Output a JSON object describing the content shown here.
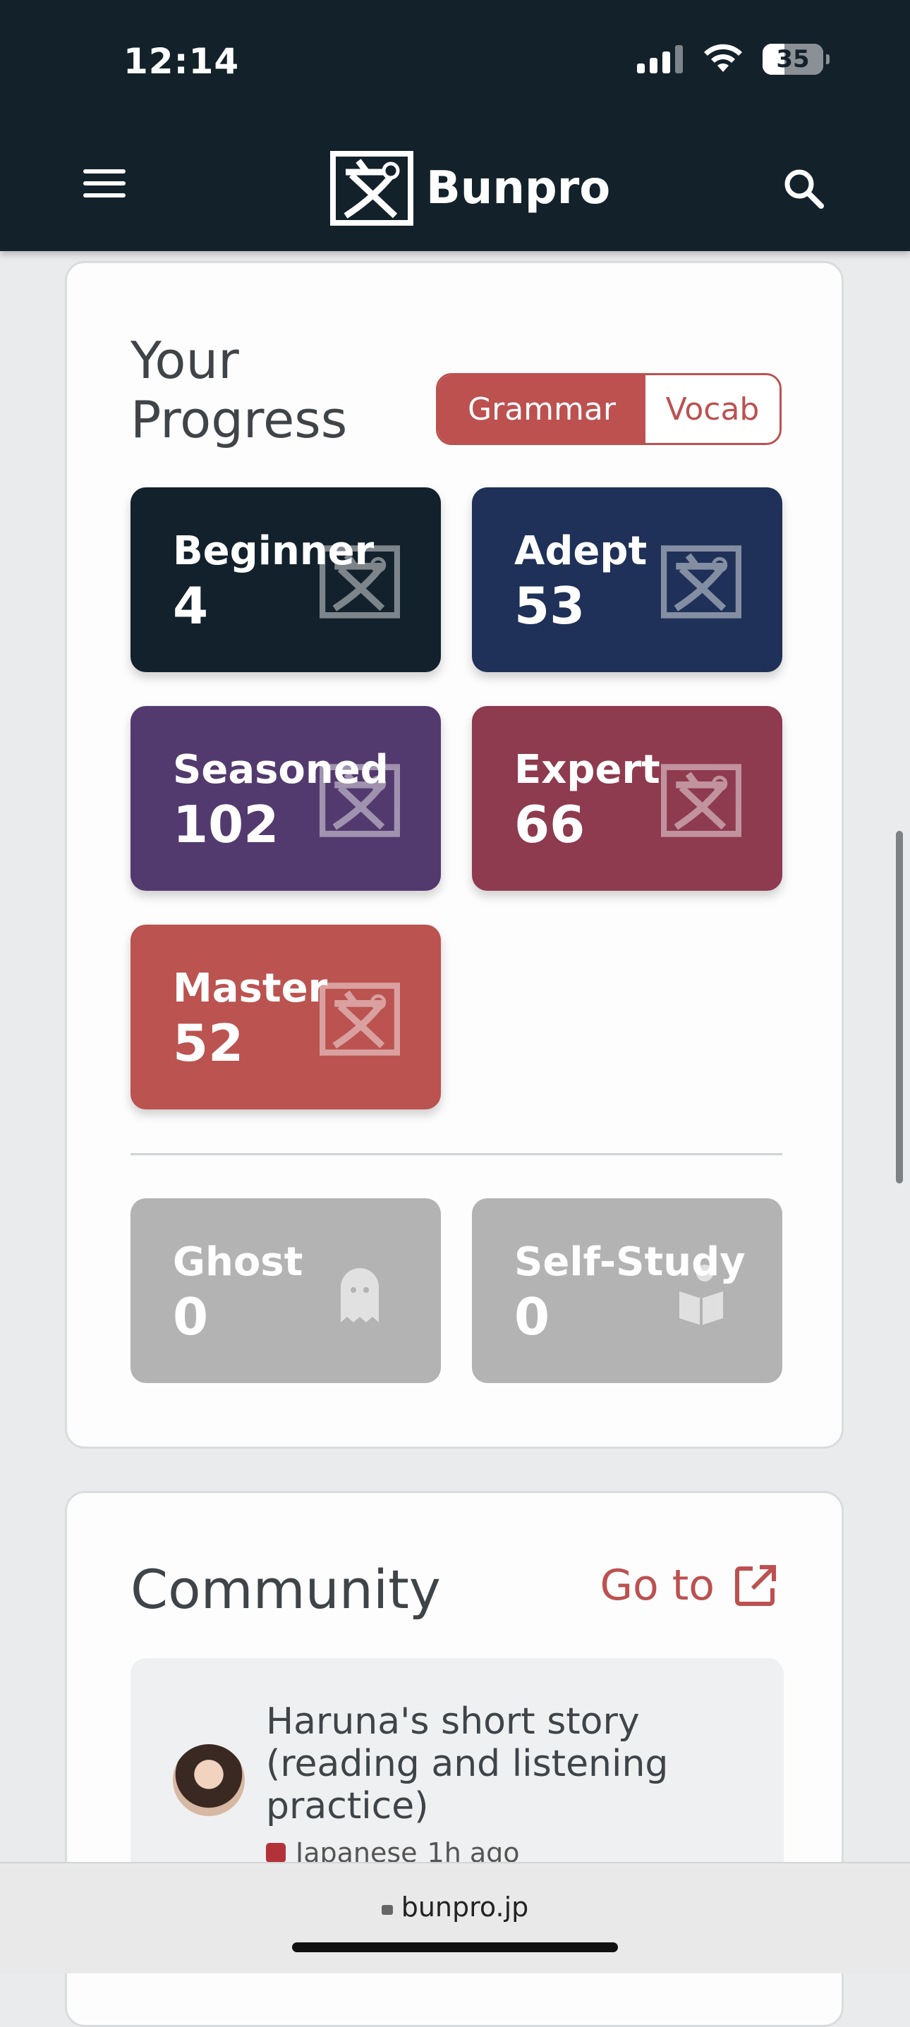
{
  "status_bar": {
    "time": "12:14",
    "battery": "35"
  },
  "header": {
    "brand": "Bunpro"
  },
  "progress": {
    "title": "Your Progress",
    "toggle": {
      "grammar": "Grammar",
      "vocab": "Vocab",
      "selected": "Grammar"
    },
    "tiles": [
      {
        "label": "Beginner",
        "count": "4",
        "color": "#12212b"
      },
      {
        "label": "Adept",
        "count": "53",
        "color": "#1f3158"
      },
      {
        "label": "Seasoned",
        "count": "102",
        "color": "#533a6e"
      },
      {
        "label": "Expert",
        "count": "66",
        "color": "#8e3a4f"
      },
      {
        "label": "Master",
        "count": "52",
        "color": "#bb5350"
      }
    ],
    "extra_tiles": [
      {
        "label": "Ghost",
        "count": "0",
        "icon": "ghost-icon"
      },
      {
        "label": "Self-Study",
        "count": "0",
        "icon": "book-icon"
      }
    ]
  },
  "community": {
    "title": "Community",
    "goto_label": "Go to",
    "post": {
      "title": "Haruna's short story (reading and listening practice)",
      "category": "Japanese",
      "time": "1h ago"
    }
  },
  "browser": {
    "url": "bunpro.jp"
  }
}
